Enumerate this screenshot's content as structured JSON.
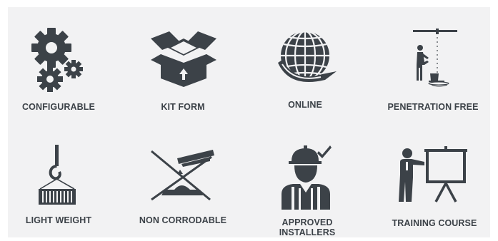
{
  "features": [
    {
      "label": "CONFIGURABLE",
      "icon": "gears-icon"
    },
    {
      "label": "KIT FORM",
      "icon": "open-box-icon"
    },
    {
      "label": "ONLINE",
      "icon": "globe-icon"
    },
    {
      "label": "PENETRATION FREE",
      "icon": "drilling-ceiling-icon"
    },
    {
      "label": "LIGHT WEIGHT",
      "icon": "crane-hook-icon"
    },
    {
      "label": "NON CORRODABLE",
      "icon": "no-corrosion-icon"
    },
    {
      "label": "APPROVED\nINSTALLERS",
      "icon": "approved-installer-icon"
    },
    {
      "label": "TRAINING COURSE",
      "icon": "presentation-icon"
    }
  ],
  "colors": {
    "icon": "#3c4248",
    "background": "#f2f2f3"
  }
}
